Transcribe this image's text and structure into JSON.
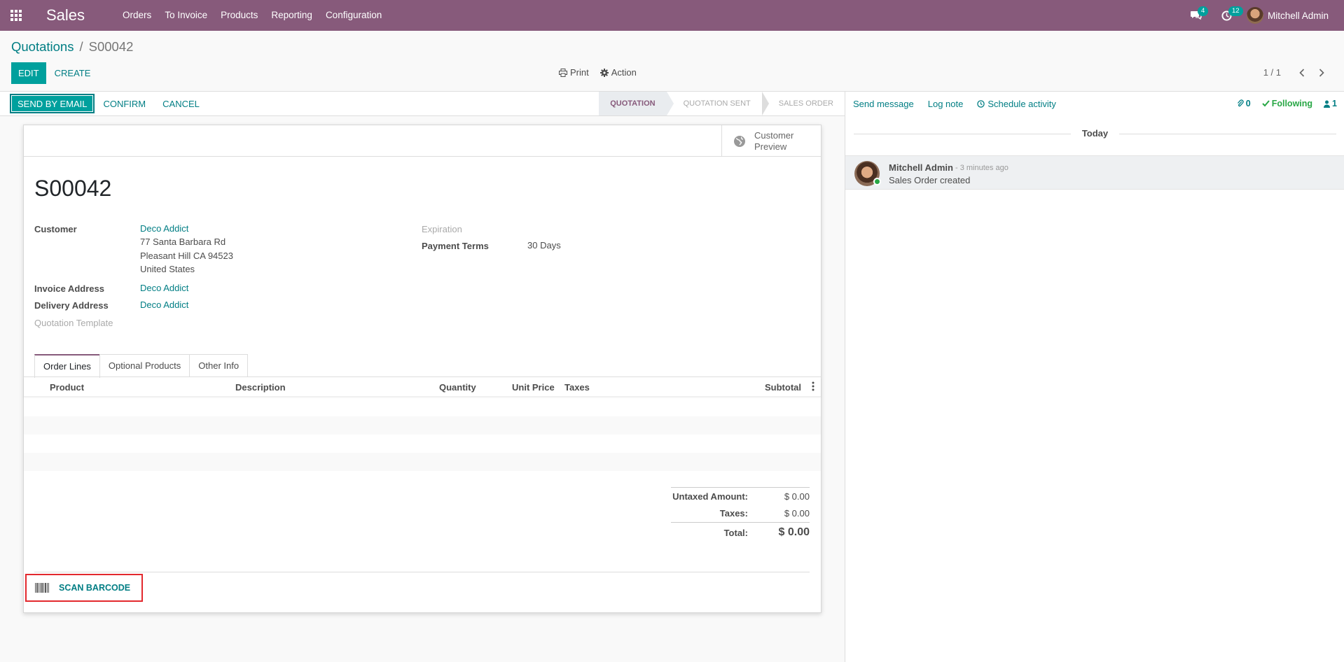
{
  "navbar": {
    "app_name": "Sales",
    "menu": [
      "Orders",
      "To Invoice",
      "Products",
      "Reporting",
      "Configuration"
    ],
    "messages_count": "4",
    "activities_count": "12",
    "user_name": "Mitchell Admin",
    "color": "#875a7b"
  },
  "breadcrumb": {
    "parent": "Quotations",
    "separator": "/",
    "current": "S00042"
  },
  "control_panel": {
    "edit": "EDIT",
    "create": "CREATE",
    "print": "Print",
    "action": "Action",
    "pager": "1 / 1"
  },
  "statusbar": {
    "send_by_email": "SEND BY EMAIL",
    "confirm": "CONFIRM",
    "cancel": "CANCEL",
    "stages": [
      "QUOTATION",
      "QUOTATION SENT",
      "SALES ORDER"
    ],
    "active_stage": "QUOTATION"
  },
  "form": {
    "preview_line1": "Customer",
    "preview_line2": "Preview",
    "title": "S00042",
    "customer_label": "Customer",
    "customer_name": "Deco Addict",
    "customer_address": [
      "77 Santa Barbara Rd",
      "Pleasant Hill CA 94523",
      "United States"
    ],
    "invoice_address_label": "Invoice Address",
    "invoice_address": "Deco Addict",
    "delivery_address_label": "Delivery Address",
    "delivery_address": "Deco Addict",
    "quotation_template_label": "Quotation Template",
    "expiration_label": "Expiration",
    "payment_terms_label": "Payment Terms",
    "payment_terms": "30 Days"
  },
  "tabs": [
    "Order Lines",
    "Optional Products",
    "Other Info"
  ],
  "table": {
    "columns": [
      "Product",
      "Description",
      "Quantity",
      "Unit Price",
      "Taxes",
      "Subtotal"
    ]
  },
  "totals": {
    "untaxed_label": "Untaxed Amount:",
    "untaxed_value": "$ 0.00",
    "taxes_label": "Taxes:",
    "taxes_value": "$ 0.00",
    "total_label": "Total:",
    "total_value": "$ 0.00"
  },
  "scan_barcode": "SCAN BARCODE",
  "chatter": {
    "send_message": "Send message",
    "log_note": "Log note",
    "schedule_activity": "Schedule activity",
    "attachments": "0",
    "following": "Following",
    "followers": "1",
    "today": "Today",
    "message": {
      "author": "Mitchell Admin",
      "date": "- 3 minutes ago",
      "body": "Sales Order created"
    }
  }
}
